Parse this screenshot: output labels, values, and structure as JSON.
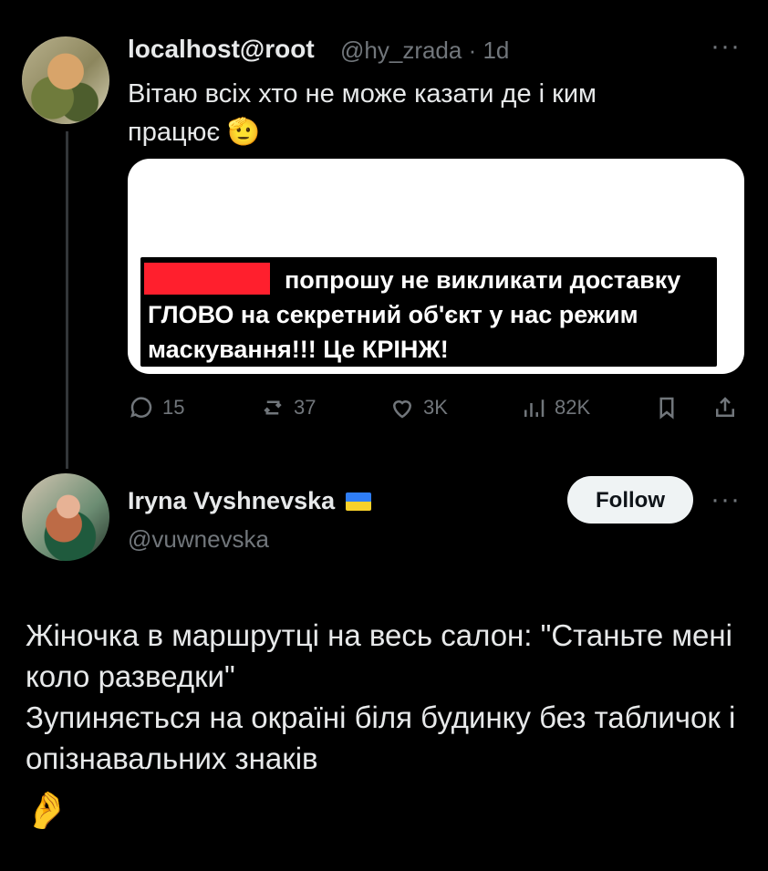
{
  "tweet1": {
    "display_name": "localhost@root",
    "handle_time": "@hy_zrada · 1d",
    "more_icon": "more-horizontal-icon",
    "text": "Вітаю всіх хто не може казати де і ким працює 🫡",
    "media_caption": "попрошу не викликати доставку ГЛОВО на секретний об'єкт у нас режим маскування!!! Це КРІНЖ!",
    "actions": {
      "replies": "15",
      "reposts": "37",
      "likes": "3K",
      "views": "82K"
    }
  },
  "tweet2": {
    "display_name": "Iryna Vyshnevska",
    "handle": "@vuwnevska",
    "follow_label": "Follow",
    "more_icon": "more-horizontal-icon",
    "text": "Жіночка в маршрутці на весь салон: \"Станьте мені коло разведки\"\nЗупиняється на окраїні біля будинку без табличок і опізнавальних знаків",
    "emoji": "🤌"
  },
  "colors": {
    "background": "#000000",
    "text": "#e7e9ea",
    "muted": "#71767b",
    "redaction": "#ff1f2d"
  }
}
